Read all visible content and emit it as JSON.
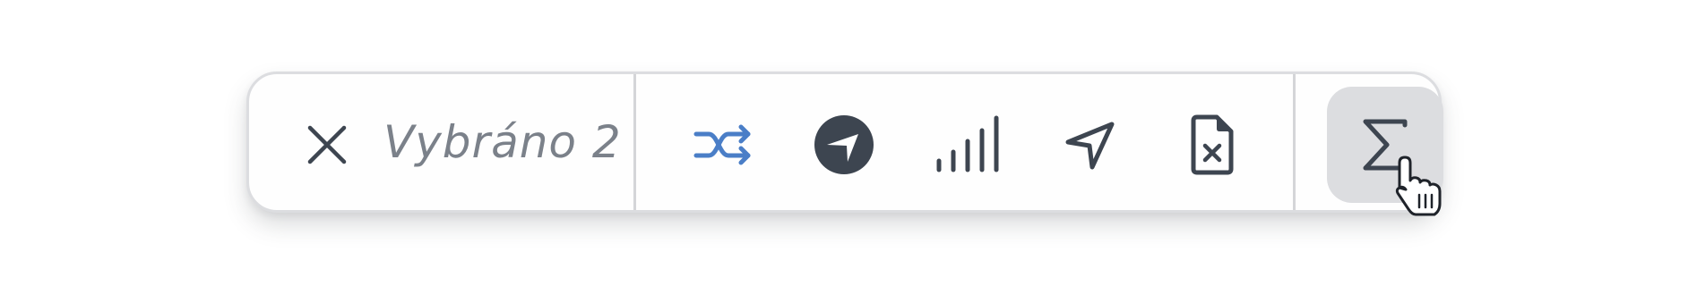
{
  "selection_toolbar": {
    "selection_label": "Vybráno 2",
    "actions": [
      {
        "id": "close",
        "icon": "close-icon"
      },
      {
        "id": "shuffle",
        "icon": "shuffle-icon",
        "color": "#4a7ec7"
      },
      {
        "id": "navigate-filled",
        "icon": "navigation-circle-icon"
      },
      {
        "id": "signal",
        "icon": "signal-bars-icon"
      },
      {
        "id": "send",
        "icon": "send-arrow-icon"
      },
      {
        "id": "delete-file",
        "icon": "file-x-icon"
      },
      {
        "id": "sum",
        "icon": "sigma-icon",
        "state": "hover"
      }
    ],
    "colors": {
      "icon": "#3d4550",
      "accent": "#4a7ec7",
      "label": "#7b818a",
      "border": "#dcdde0",
      "hover_bg": "#dcdde0"
    }
  }
}
